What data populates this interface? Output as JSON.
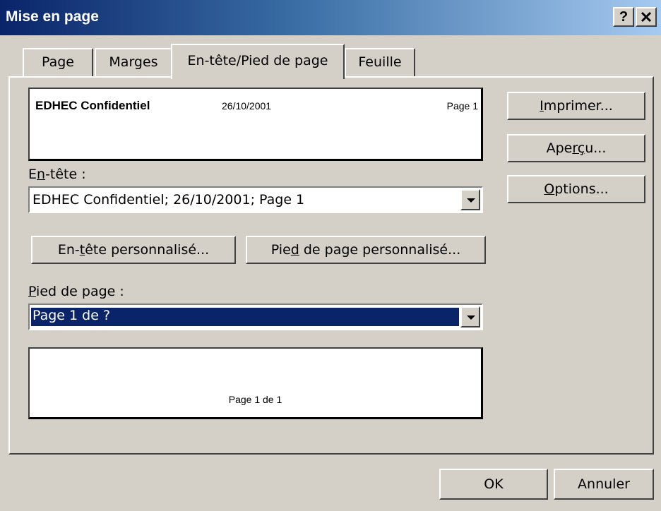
{
  "window": {
    "title": "Mise en page",
    "help_label": "?",
    "close_label": "×"
  },
  "tabs": [
    {
      "label": "Page"
    },
    {
      "label": "Marges"
    },
    {
      "label": "En-tête/Pied de page"
    },
    {
      "label": "Feuille"
    }
  ],
  "header_preview": {
    "left": "EDHEC Confidentiel",
    "center": "26/10/2001",
    "right": "Page 1"
  },
  "header": {
    "label_pre": "E",
    "label_accel": "n",
    "label_post": "-tête :",
    "value": "EDHEC Confidentiel; 26/10/2001; Page 1"
  },
  "custom_buttons": {
    "header_pre": "En-",
    "header_accel": "t",
    "header_post": "ête personnalisé...",
    "footer_pre": "Pie",
    "footer_accel": "d",
    "footer_post": " de page personnalisé..."
  },
  "footer": {
    "label_accel": "P",
    "label_post": "ied de page :",
    "value": "Page 1 de ?"
  },
  "footer_preview": {
    "center": "Page 1 de 1"
  },
  "side_buttons": {
    "print_accel": "I",
    "print_post": "mprimer...",
    "preview_pre": "Ape",
    "preview_accel": "r",
    "preview_mid": "ç",
    "preview_post": "u...",
    "options_accel": "O",
    "options_post": "ptions..."
  },
  "bottom_buttons": {
    "ok": "OK",
    "cancel": "Annuler"
  },
  "colors": {
    "face": "#d4d0c8",
    "selection": "#0a246a",
    "title_start": "#0a246a",
    "title_end": "#a6caf0"
  }
}
